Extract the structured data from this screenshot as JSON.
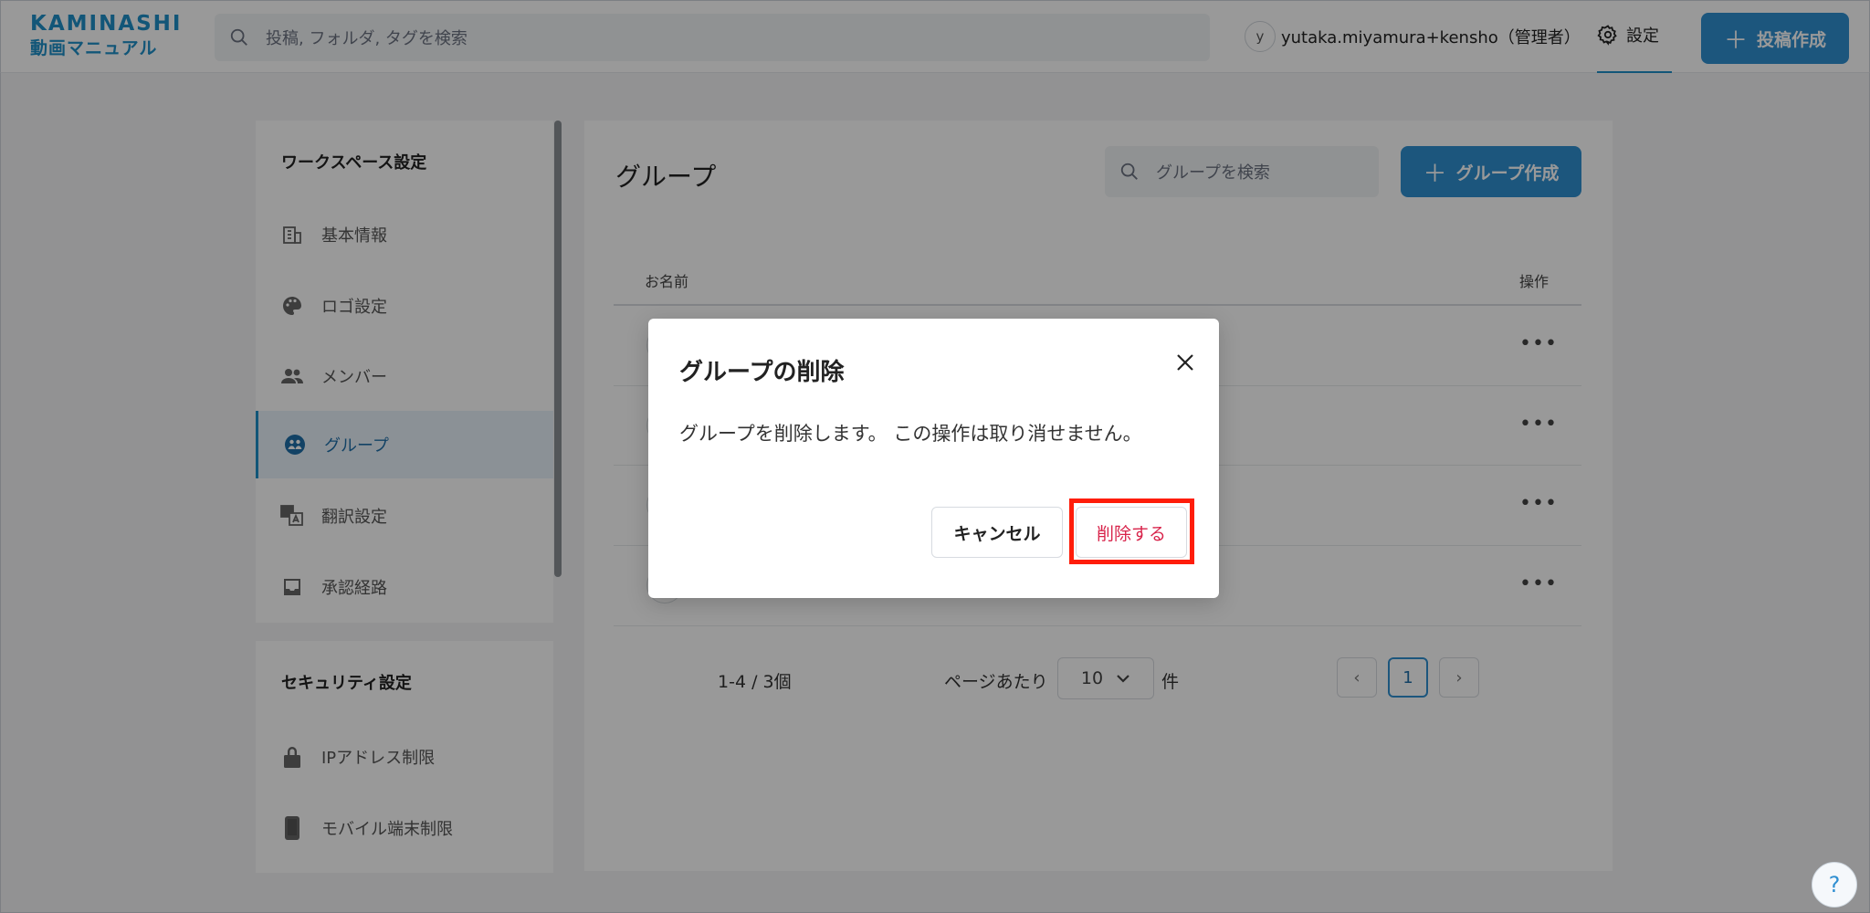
{
  "header": {
    "logo_top": "KAMINASHI",
    "logo_bottom": "動画マニュアル",
    "search_placeholder": "投稿, フォルダ, タグを検索",
    "user_initial": "y",
    "user_name": "yutaka.miyamura+kensho（管理者）",
    "settings_label": "設定",
    "create_post_label": "投稿作成"
  },
  "sidebar": {
    "workspace_heading": "ワークスペース設定",
    "items": [
      {
        "label": "基本情報",
        "icon": "building-icon"
      },
      {
        "label": "ロゴ設定",
        "icon": "palette-icon"
      },
      {
        "label": "メンバー",
        "icon": "people-icon"
      },
      {
        "label": "グループ",
        "icon": "group-icon",
        "active": true
      },
      {
        "label": "翻訳設定",
        "icon": "translate-icon"
      },
      {
        "label": "承認経路",
        "icon": "inbox-icon"
      }
    ],
    "security_heading": "セキュリティ設定",
    "security_items": [
      {
        "label": "IPアドレス制限",
        "icon": "lock-icon"
      },
      {
        "label": "モバイル端末制限",
        "icon": "mobile-icon"
      }
    ]
  },
  "main": {
    "title": "グループ",
    "search_placeholder": "グループを検索",
    "create_group_label": "グループ作成",
    "columns": {
      "name": "お名前",
      "ops": "操作"
    },
    "row_more": "•••",
    "count_text": "1-4 / 3個",
    "per_page_label": "ページあたり",
    "per_page_value": "10",
    "per_page_unit": "件",
    "pagination": {
      "prev": "‹",
      "current": "1",
      "next": "›"
    }
  },
  "modal": {
    "title": "グループの削除",
    "message": "グループを削除します。 この操作は取り消せません。",
    "cancel_label": "キャンセル",
    "delete_label": "削除する"
  },
  "help_label": "?",
  "colors": {
    "accent": "#2f8fd1",
    "danger_text": "#d8234a",
    "highlight": "#ff1d0a"
  }
}
